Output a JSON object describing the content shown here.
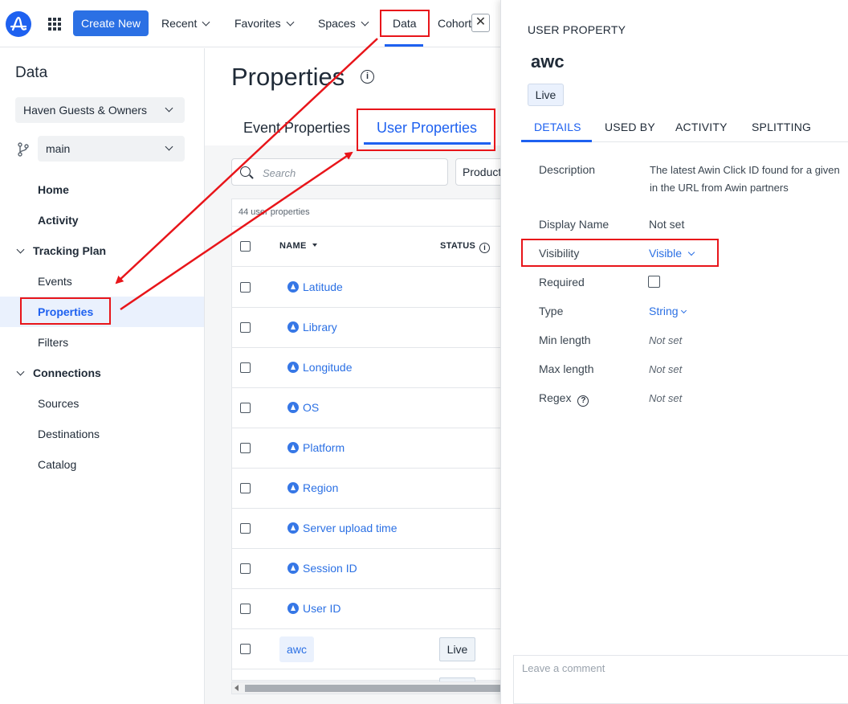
{
  "topnav": {
    "create_label": "Create New",
    "items": [
      "Recent",
      "Favorites",
      "Spaces",
      "Data",
      "Cohort"
    ]
  },
  "sidebar": {
    "title": "Data",
    "project": "Haven Guests & Owners",
    "branch": "main",
    "items": {
      "home": "Home",
      "activity": "Activity",
      "tracking_plan": "Tracking Plan",
      "events": "Events",
      "properties": "Properties",
      "filters": "Filters",
      "connections": "Connections",
      "sources": "Sources",
      "destinations": "Destinations",
      "catalog": "Catalog"
    }
  },
  "main": {
    "title": "Properties",
    "tabs": [
      "Event Properties",
      "User Properties"
    ],
    "search_placeholder": "Search",
    "product_filter": "Product",
    "count_label": "44 user properties",
    "columns": {
      "name": "NAME",
      "status": "STATUS"
    },
    "rows": [
      "Latitude",
      "Library",
      "Longitude",
      "OS",
      "Platform",
      "Region",
      "Server upload time",
      "Session ID",
      "User ID"
    ],
    "custom_row": {
      "name": "awc",
      "status": "Live"
    }
  },
  "panel": {
    "heading": "USER PROPERTY",
    "title": "awc",
    "badge": "Live",
    "tabs": [
      "DETAILS",
      "USED BY",
      "ACTIVITY",
      "SPLITTING"
    ],
    "description_label": "Description",
    "description_lines": [
      "The latest Awin Click ID found for a given",
      "in the URL from Awin partners"
    ],
    "display_name_label": "Display Name",
    "display_name_value": "Not set",
    "visibility_label": "Visibility",
    "visibility_value": "Visible",
    "required_label": "Required",
    "type_label": "Type",
    "type_value": "String",
    "min_length_label": "Min length",
    "min_length_value": "Not set",
    "max_length_label": "Max length",
    "max_length_value": "Not set",
    "regex_label": "Regex",
    "regex_value": "Not set",
    "comment_placeholder": "Leave a comment"
  },
  "colors": {
    "accent": "#1e61f0",
    "annotation": "#e8151a",
    "active_bg": "#eaf1fd"
  }
}
